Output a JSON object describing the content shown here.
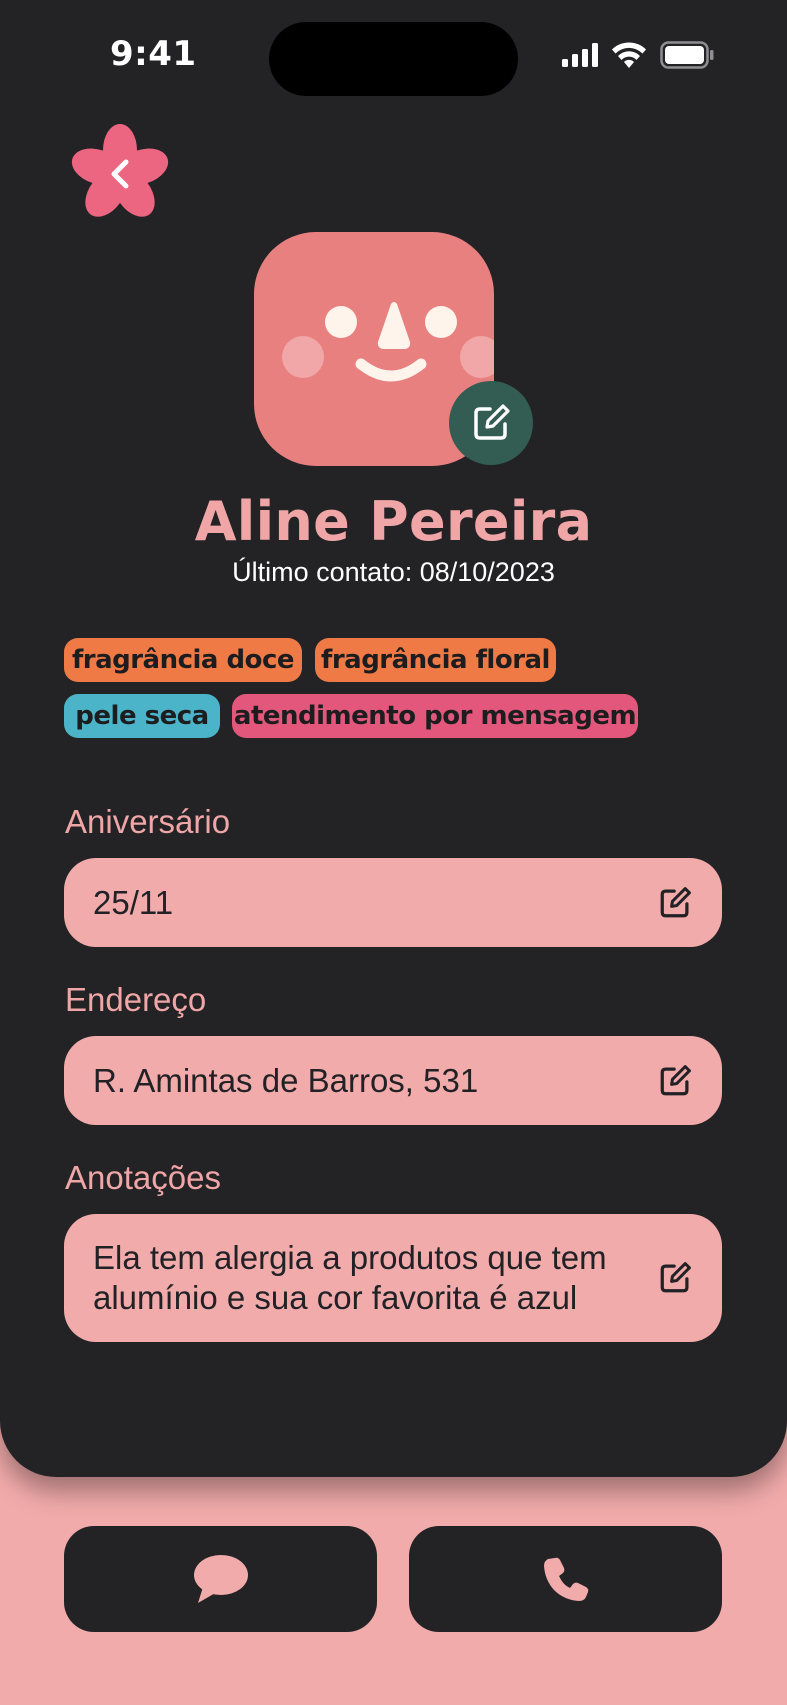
{
  "status_bar": {
    "time": "9:41"
  },
  "header": {
    "back_icon": "chevron-left-icon"
  },
  "profile": {
    "name": "Aline Pereira",
    "last_contact": "Último contato: 08/10/2023",
    "avatar_icon": "smiley-face-avatar",
    "edit_icon": "edit-icon"
  },
  "tags": [
    {
      "label": "fragrância doce",
      "color": "#f07a45"
    },
    {
      "label": "fragrância floral",
      "color": "#f07a45"
    },
    {
      "label": "pele seca",
      "color": "#4bb4c8"
    },
    {
      "label": "atendimento por mensagem",
      "color": "#e4577c"
    }
  ],
  "fields": {
    "birthday": {
      "label": "Aniversário",
      "value": "25/11"
    },
    "address": {
      "label": "Endereço",
      "value": "R. Amintas de Barros, 531"
    },
    "notes": {
      "label": "Anotações",
      "value": "Ela tem alergia a produtos que tem alumínio e sua cor favorita é azul"
    }
  },
  "actions": {
    "message_icon": "chat-bubble-icon",
    "call_icon": "phone-icon"
  },
  "colors": {
    "background": "#f2abab",
    "card": "#232326",
    "accent": "#f0a6a6",
    "avatar": "#e98080",
    "edit_badge": "#335c52"
  }
}
